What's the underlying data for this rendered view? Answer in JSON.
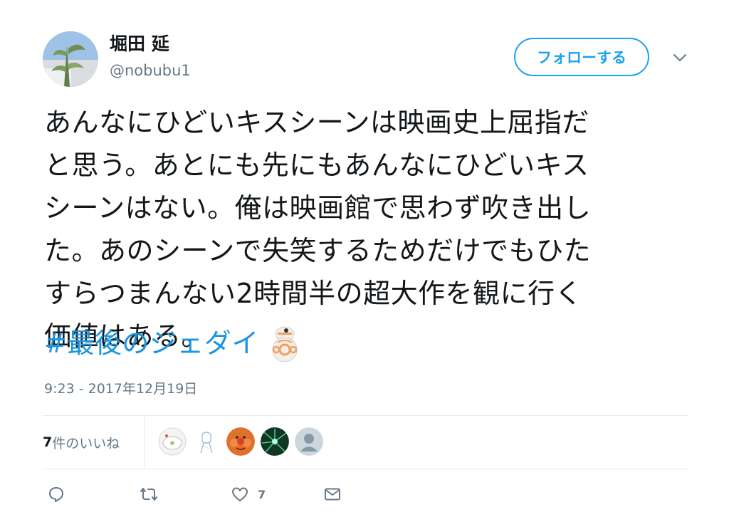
{
  "author": {
    "display_name": "堀田 延",
    "handle": "@nobubu1"
  },
  "follow_button_label": "フォローする",
  "tweet": {
    "lines": [
      "あんなにひどいキスシーンは映画史上屈指だ",
      "と思う。あとにも先にもあんなにひどいキス",
      "シーンはない。俺は映画館で思わず吹き出し",
      "た。あのシーンで失笑するためだけでもひた",
      "すらつまんない2時間半の超大作を観に行く",
      "価値はある。"
    ],
    "hashtag": "#最後のジェダイ",
    "hashtag_emoji": "bb8-emoji"
  },
  "timestamp": "9:23 - 2017年12月19日",
  "stats": {
    "likes_number": "7",
    "likes_suffix": "件のいいね",
    "likers": [
      "liker-avatar-1",
      "liker-avatar-2",
      "liker-avatar-3",
      "liker-avatar-4",
      "liker-avatar-5"
    ]
  },
  "actions": {
    "reply_icon": "reply-icon",
    "retweet_icon": "retweet-icon",
    "like_icon": "heart-icon",
    "like_count": "7",
    "dm_icon": "envelope-icon"
  },
  "colors": {
    "accent": "#1da1f2",
    "hashtag": "#1b95e0",
    "secondary_text": "#657786",
    "divider": "#e6ecf0"
  }
}
